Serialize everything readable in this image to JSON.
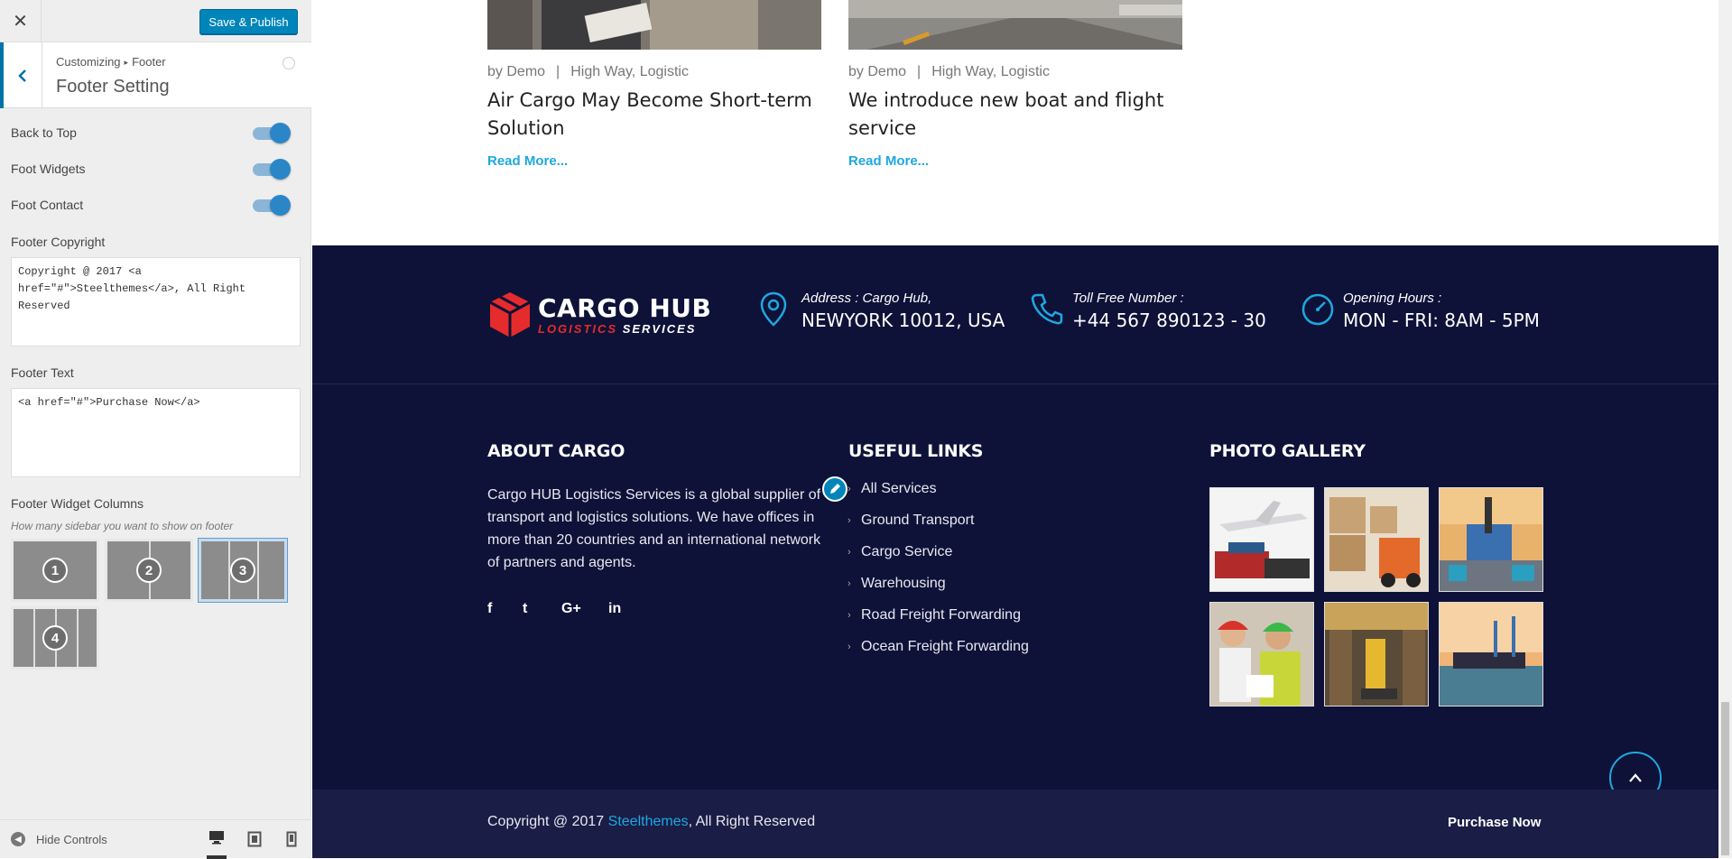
{
  "customizer": {
    "publish_label": "Save & Publish",
    "close_glyph": "✕",
    "breadcrumb_root": "Customizing",
    "breadcrumb_sep": "▸",
    "breadcrumb_section": "Footer",
    "panel_title": "Footer Setting",
    "toggles": [
      {
        "label": "Back to Top",
        "on": true
      },
      {
        "label": "Foot Widgets",
        "on": true
      },
      {
        "label": "Foot Contact",
        "on": true
      }
    ],
    "copyright_label": "Footer Copyright",
    "copyright_value": "Copyright @ 2017 <a href=\"#\">Steelthemes</a>, All Right Reserved",
    "text_label": "Footer Text",
    "text_value": "<a href=\"#\">Purchase Now</a>",
    "columns_label": "Footer Widget Columns",
    "columns_desc": "How many sidebar you want to show on footer",
    "column_options": [
      "1",
      "2",
      "3",
      "4"
    ],
    "column_selected": "3",
    "hide_controls": "Hide Controls",
    "accent": "#0085ba"
  },
  "posts": [
    {
      "by": "by",
      "author": "Demo",
      "sep": "|",
      "cat1": "High Way",
      "comma": ",",
      "cat2": "Logistic",
      "title": "Air Cargo May Become Short-term Solution",
      "read_more": "Read More..."
    },
    {
      "by": "by",
      "author": "Demo",
      "sep": "|",
      "cat1": "High Way",
      "comma": ",",
      "cat2": "Logistic",
      "title": "We introduce new boat and flight service",
      "read_more": "Read More..."
    }
  ],
  "footer": {
    "brand_name": "CARGO HUB",
    "brand_sub_red": "LOGISTICS",
    "brand_sub_white": "SERVICES",
    "contacts": [
      {
        "icon": "map-pin-icon",
        "label": "Address : Cargo Hub,",
        "value": "NEWYORK 10012, USA"
      },
      {
        "icon": "phone-icon",
        "label": "Toll Free Number :",
        "value": "+44 567 890123 - 30"
      },
      {
        "icon": "clock-icon",
        "label": "Opening Hours :",
        "value": "MON - FRI: 8AM - 5PM"
      }
    ],
    "about_title": "ABOUT CARGO",
    "about_text": "Cargo HUB Logistics Services is a global supplier of transport and logistics solutions. We have offices in more than 20 countries and an international network of partners and agents.",
    "social": [
      "f",
      "t",
      "G+",
      "in"
    ],
    "links_title": "USEFUL LINKS",
    "links": [
      "All Services",
      "Ground Transport",
      "Cargo Service",
      "Warehousing",
      "Road Freight Forwarding",
      "Ocean Freight Forwarding"
    ],
    "gallery_title": "PHOTO GALLERY",
    "gallery": [
      "airplane-cargo-photo",
      "forklift-boxes-photo",
      "container-port-photo",
      "workers-photo",
      "warehouse-photo",
      "cargo-ship-photo"
    ],
    "copyright_pre": "Copyright @ 2017 ",
    "copyright_link": "Steelthemes",
    "copyright_post": ", All Right Reserved",
    "purchase": "Purchase Now",
    "bg_color": "#0e1238",
    "accent": "#1ea8e0",
    "brand_red": "#e52b2b"
  }
}
